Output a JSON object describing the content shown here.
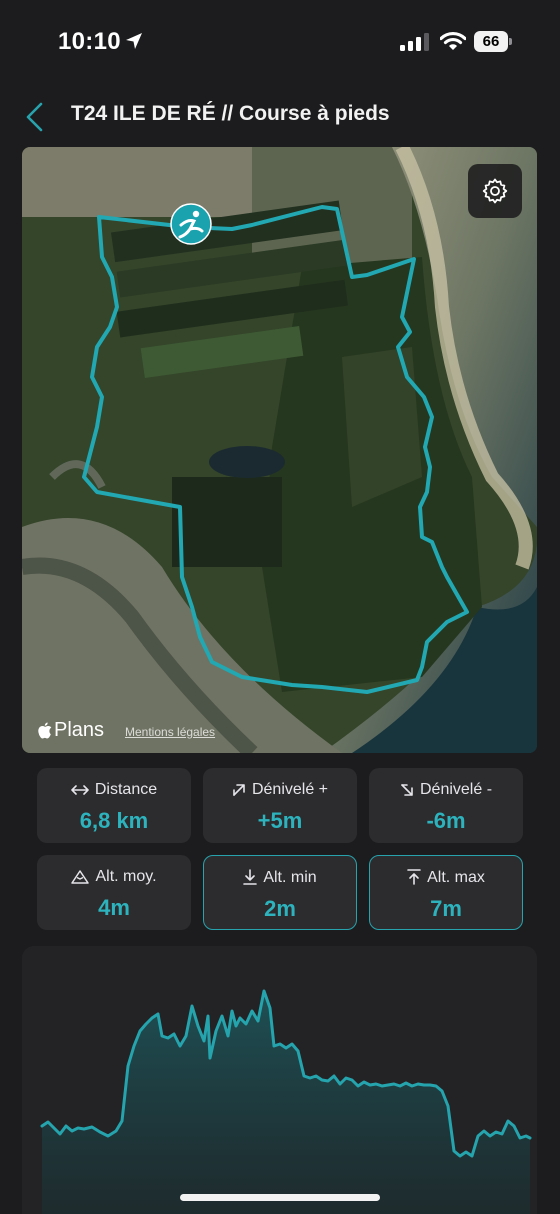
{
  "status_bar": {
    "time": "10:10",
    "battery": "66",
    "icons": [
      "location-arrow-icon",
      "cellular-signal-icon",
      "wifi-icon",
      "battery-icon"
    ]
  },
  "header": {
    "back_icon": "chevron-left-icon",
    "title": "T24 ILE DE RÉ // Course à pieds"
  },
  "map": {
    "attribution_brand": "Plans",
    "legal_link": "Mentions légales",
    "settings_icon": "gear-icon",
    "start_marker_icon": "runner-icon",
    "route_color": "#22a8b2"
  },
  "stats": [
    {
      "icon": "horizontal-arrows-icon",
      "label": "Distance",
      "value": "6,8 km",
      "highlighted": false
    },
    {
      "icon": "uphill-arrow-icon",
      "label": "Dénivelé +",
      "value": "+5m",
      "highlighted": false
    },
    {
      "icon": "downhill-arrow-icon",
      "label": "Dénivelé -",
      "value": "-6m",
      "highlighted": false
    },
    {
      "icon": "mountain-icon",
      "label": "Alt. moy.",
      "value": "4m",
      "highlighted": false
    },
    {
      "icon": "download-arrow-icon",
      "label": "Alt. min",
      "value": "2m",
      "highlighted": true
    },
    {
      "icon": "upload-arrow-icon",
      "label": "Alt. max",
      "value": "7m",
      "highlighted": true
    }
  ],
  "elevation_chart": {
    "line_color": "#25a4ae",
    "y_range_m": [
      2,
      7
    ]
  },
  "colors": {
    "accent": "#2cb3bd",
    "background": "#1c1c1e",
    "card": "#2c2c2e"
  }
}
